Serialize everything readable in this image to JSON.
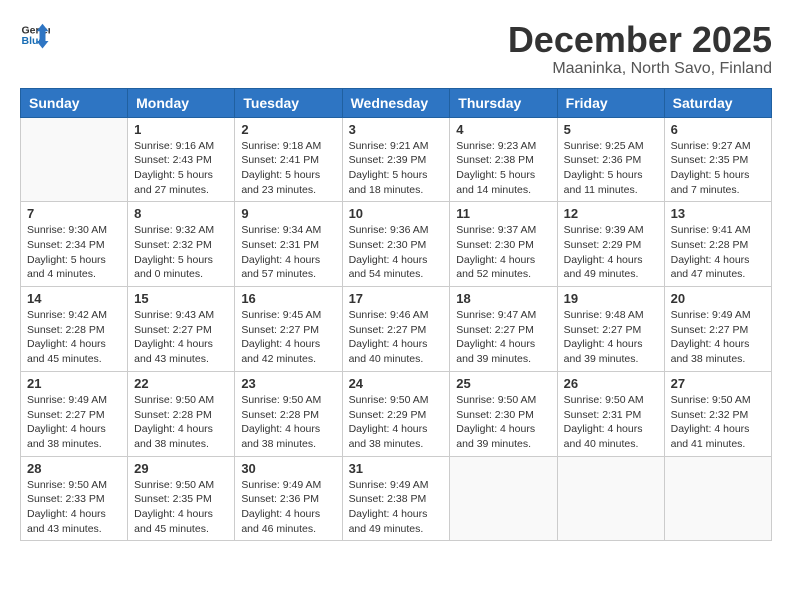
{
  "header": {
    "logo_general": "General",
    "logo_blue": "Blue",
    "title": "December 2025",
    "subtitle": "Maaninka, North Savo, Finland"
  },
  "days_of_week": [
    "Sunday",
    "Monday",
    "Tuesday",
    "Wednesday",
    "Thursday",
    "Friday",
    "Saturday"
  ],
  "weeks": [
    [
      {
        "day": "",
        "info": ""
      },
      {
        "day": "1",
        "info": "Sunrise: 9:16 AM\nSunset: 2:43 PM\nDaylight: 5 hours\nand 27 minutes."
      },
      {
        "day": "2",
        "info": "Sunrise: 9:18 AM\nSunset: 2:41 PM\nDaylight: 5 hours\nand 23 minutes."
      },
      {
        "day": "3",
        "info": "Sunrise: 9:21 AM\nSunset: 2:39 PM\nDaylight: 5 hours\nand 18 minutes."
      },
      {
        "day": "4",
        "info": "Sunrise: 9:23 AM\nSunset: 2:38 PM\nDaylight: 5 hours\nand 14 minutes."
      },
      {
        "day": "5",
        "info": "Sunrise: 9:25 AM\nSunset: 2:36 PM\nDaylight: 5 hours\nand 11 minutes."
      },
      {
        "day": "6",
        "info": "Sunrise: 9:27 AM\nSunset: 2:35 PM\nDaylight: 5 hours\nand 7 minutes."
      }
    ],
    [
      {
        "day": "7",
        "info": "Sunrise: 9:30 AM\nSunset: 2:34 PM\nDaylight: 5 hours\nand 4 minutes."
      },
      {
        "day": "8",
        "info": "Sunrise: 9:32 AM\nSunset: 2:32 PM\nDaylight: 5 hours\nand 0 minutes."
      },
      {
        "day": "9",
        "info": "Sunrise: 9:34 AM\nSunset: 2:31 PM\nDaylight: 4 hours\nand 57 minutes."
      },
      {
        "day": "10",
        "info": "Sunrise: 9:36 AM\nSunset: 2:30 PM\nDaylight: 4 hours\nand 54 minutes."
      },
      {
        "day": "11",
        "info": "Sunrise: 9:37 AM\nSunset: 2:30 PM\nDaylight: 4 hours\nand 52 minutes."
      },
      {
        "day": "12",
        "info": "Sunrise: 9:39 AM\nSunset: 2:29 PM\nDaylight: 4 hours\nand 49 minutes."
      },
      {
        "day": "13",
        "info": "Sunrise: 9:41 AM\nSunset: 2:28 PM\nDaylight: 4 hours\nand 47 minutes."
      }
    ],
    [
      {
        "day": "14",
        "info": "Sunrise: 9:42 AM\nSunset: 2:28 PM\nDaylight: 4 hours\nand 45 minutes."
      },
      {
        "day": "15",
        "info": "Sunrise: 9:43 AM\nSunset: 2:27 PM\nDaylight: 4 hours\nand 43 minutes."
      },
      {
        "day": "16",
        "info": "Sunrise: 9:45 AM\nSunset: 2:27 PM\nDaylight: 4 hours\nand 42 minutes."
      },
      {
        "day": "17",
        "info": "Sunrise: 9:46 AM\nSunset: 2:27 PM\nDaylight: 4 hours\nand 40 minutes."
      },
      {
        "day": "18",
        "info": "Sunrise: 9:47 AM\nSunset: 2:27 PM\nDaylight: 4 hours\nand 39 minutes."
      },
      {
        "day": "19",
        "info": "Sunrise: 9:48 AM\nSunset: 2:27 PM\nDaylight: 4 hours\nand 39 minutes."
      },
      {
        "day": "20",
        "info": "Sunrise: 9:49 AM\nSunset: 2:27 PM\nDaylight: 4 hours\nand 38 minutes."
      }
    ],
    [
      {
        "day": "21",
        "info": "Sunrise: 9:49 AM\nSunset: 2:27 PM\nDaylight: 4 hours\nand 38 minutes."
      },
      {
        "day": "22",
        "info": "Sunrise: 9:50 AM\nSunset: 2:28 PM\nDaylight: 4 hours\nand 38 minutes."
      },
      {
        "day": "23",
        "info": "Sunrise: 9:50 AM\nSunset: 2:28 PM\nDaylight: 4 hours\nand 38 minutes."
      },
      {
        "day": "24",
        "info": "Sunrise: 9:50 AM\nSunset: 2:29 PM\nDaylight: 4 hours\nand 38 minutes."
      },
      {
        "day": "25",
        "info": "Sunrise: 9:50 AM\nSunset: 2:30 PM\nDaylight: 4 hours\nand 39 minutes."
      },
      {
        "day": "26",
        "info": "Sunrise: 9:50 AM\nSunset: 2:31 PM\nDaylight: 4 hours\nand 40 minutes."
      },
      {
        "day": "27",
        "info": "Sunrise: 9:50 AM\nSunset: 2:32 PM\nDaylight: 4 hours\nand 41 minutes."
      }
    ],
    [
      {
        "day": "28",
        "info": "Sunrise: 9:50 AM\nSunset: 2:33 PM\nDaylight: 4 hours\nand 43 minutes."
      },
      {
        "day": "29",
        "info": "Sunrise: 9:50 AM\nSunset: 2:35 PM\nDaylight: 4 hours\nand 45 minutes."
      },
      {
        "day": "30",
        "info": "Sunrise: 9:49 AM\nSunset: 2:36 PM\nDaylight: 4 hours\nand 46 minutes."
      },
      {
        "day": "31",
        "info": "Sunrise: 9:49 AM\nSunset: 2:38 PM\nDaylight: 4 hours\nand 49 minutes."
      },
      {
        "day": "",
        "info": ""
      },
      {
        "day": "",
        "info": ""
      },
      {
        "day": "",
        "info": ""
      }
    ]
  ]
}
